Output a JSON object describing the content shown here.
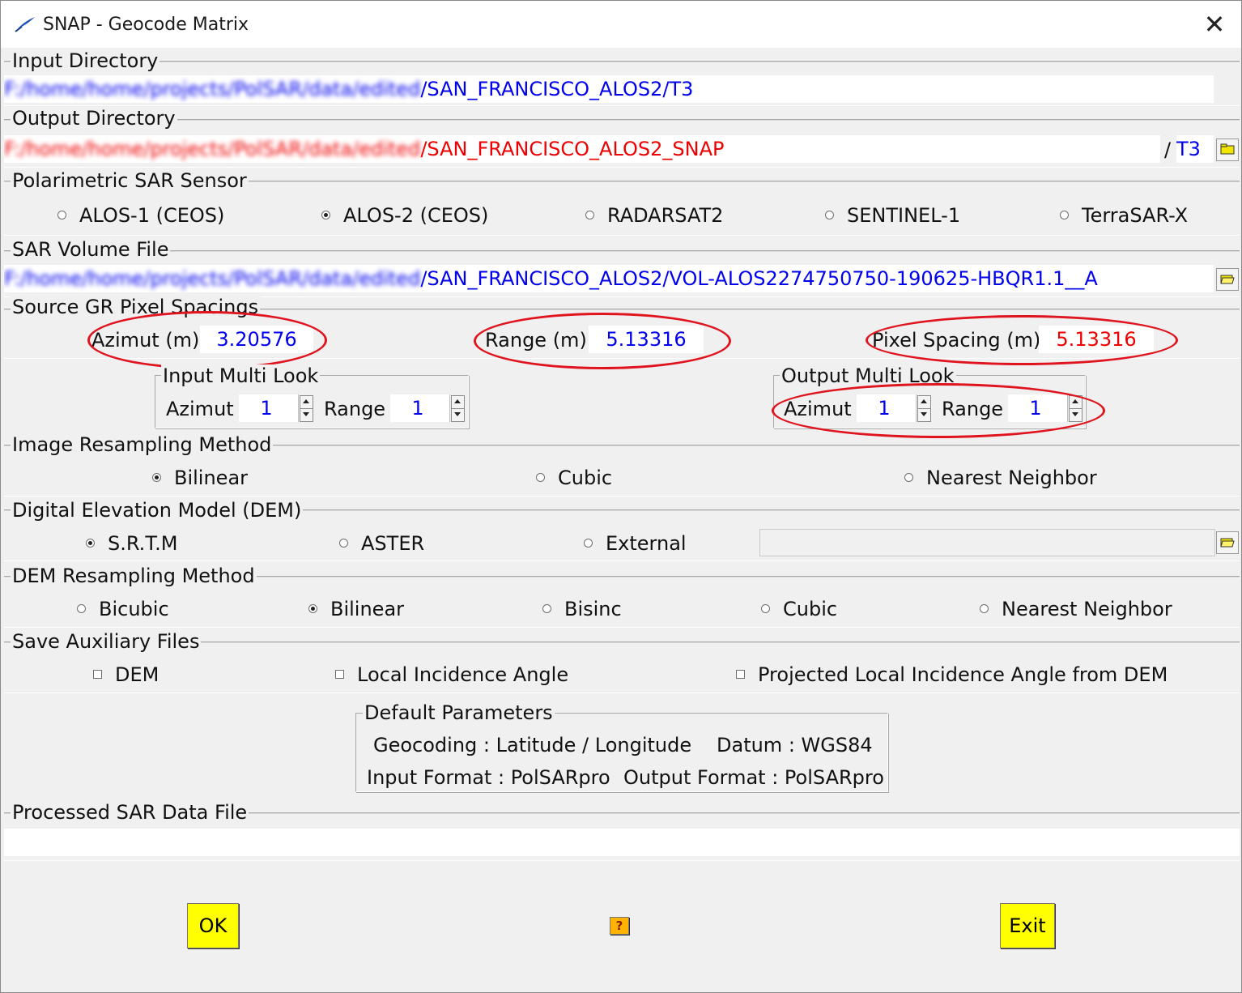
{
  "window": {
    "title": "SNAP - Geocode Matrix",
    "close_glyph": "✕"
  },
  "input_directory": {
    "legend": "Input Directory",
    "path_prefix_blurred": "F:/home/home/projects/PolSAR/data/edited",
    "path_suffix": "/SAN_FRANCISCO_ALOS2/T3"
  },
  "output_directory": {
    "legend": "Output Directory",
    "path_prefix_blurred": "F:/home/home/projects/PolSAR/data/edited",
    "path_suffix": "/SAN_FRANCISCO_ALOS2_SNAP",
    "separator": "/",
    "subdir": "T3",
    "browse_icon": "folder-icon"
  },
  "sensor": {
    "legend": "Polarimetric SAR Sensor",
    "options": [
      "ALOS-1 (CEOS)",
      "ALOS-2 (CEOS)",
      "RADARSAT2",
      "SENTINEL-1",
      "TerraSAR-X"
    ],
    "selected": "ALOS-2 (CEOS)"
  },
  "volume_file": {
    "legend": "SAR Volume File",
    "path_prefix_blurred": "F:/home/home/projects/PolSAR/data/edited",
    "path_suffix": "/SAN_FRANCISCO_ALOS2/VOL-ALOS2274750750-190625-HBQR1.1__A",
    "browse_icon": "open-folder-icon"
  },
  "pixel_spacings": {
    "legend": "Source GR Pixel Spacings",
    "azimut_label": "Azimut (m)",
    "azimut_value": "3.20576",
    "range_label": "Range (m)",
    "range_value": "5.13316",
    "pixel_label": "Pixel Spacing (m)",
    "pixel_value": "5.13316"
  },
  "input_multilook": {
    "legend": "Input Multi Look",
    "azimut_label": "Azimut",
    "azimut_value": "1",
    "range_label": "Range",
    "range_value": "1"
  },
  "output_multilook": {
    "legend": "Output Multi Look",
    "azimut_label": "Azimut",
    "azimut_value": "1",
    "range_label": "Range",
    "range_value": "1"
  },
  "image_resampling": {
    "legend": "Image Resampling Method",
    "options": [
      "Bilinear",
      "Cubic",
      "Nearest Neighbor"
    ],
    "selected": "Bilinear"
  },
  "dem": {
    "legend": "Digital Elevation Model (DEM)",
    "options": [
      "S.R.T.M",
      "ASTER",
      "External"
    ],
    "selected": "S.R.T.M",
    "external_path": "",
    "browse_icon": "open-folder-icon"
  },
  "dem_resampling": {
    "legend": "DEM Resampling Method",
    "options": [
      "Bicubic",
      "Bilinear",
      "Bisinc",
      "Cubic",
      "Nearest Neighbor"
    ],
    "selected": "Bilinear"
  },
  "aux_files": {
    "legend": "Save Auxiliary Files",
    "options": [
      "DEM",
      "Local Incidence Angle",
      "Projected Local Incidence Angle from DEM"
    ]
  },
  "defaults": {
    "legend": "Default Parameters",
    "geocoding": "Geocoding : Latitude / Longitude",
    "datum": "Datum : WGS84",
    "input_format": "Input Format : PolSARpro",
    "output_format": "Output Format : PolSARpro"
  },
  "processed_file": {
    "legend": "Processed SAR Data File",
    "value": ""
  },
  "buttons": {
    "ok": "OK",
    "help_glyph": "?",
    "exit": "Exit"
  },
  "colors": {
    "path_blue": "#0000ee",
    "path_red": "#ee0000",
    "button_yellow": "#ffff00",
    "annotation_red": "#e0141e"
  }
}
